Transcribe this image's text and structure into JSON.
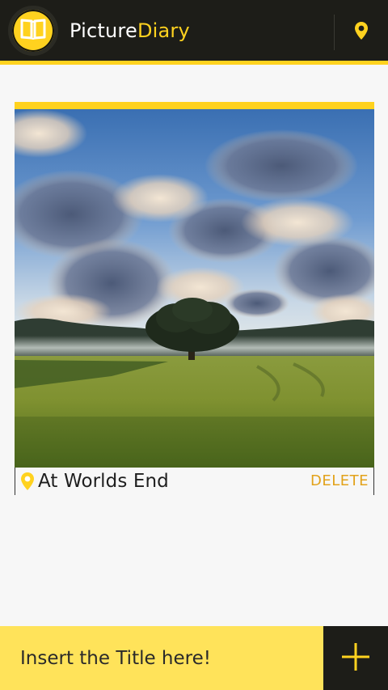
{
  "header": {
    "title_part1": "Picture",
    "title_part2": "Diary",
    "logo_icon": "open-book-icon",
    "location_icon": "map-pin-icon"
  },
  "entry": {
    "photo_description_icon": "landscape-photo",
    "location_icon": "map-pin-icon",
    "location": "At Worlds End",
    "delete_label": "DELETE"
  },
  "footer": {
    "title_placeholder": "Insert the Title here!",
    "add_icon": "plus-icon"
  },
  "colors": {
    "accent": "#ffd21f",
    "dark": "#1d1d18",
    "input_bg": "#ffe35a",
    "delete": "#e2a21a",
    "background": "#f7f7f7"
  }
}
